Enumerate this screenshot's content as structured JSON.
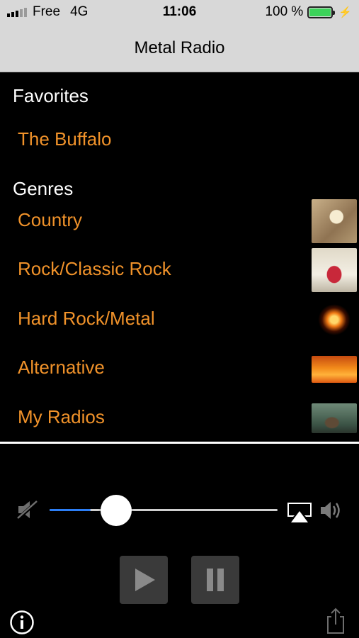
{
  "status_bar": {
    "carrier": "Free",
    "network": "4G",
    "time": "11:06",
    "battery_percent": "100 %",
    "battery_level": 1.0,
    "signal_bars_active": 3,
    "signal_bars_total": 5
  },
  "nav": {
    "title": "Metal Radio"
  },
  "favorites": {
    "header": "Favorites",
    "items": [
      {
        "label": "The Buffalo"
      }
    ]
  },
  "genres": {
    "header": "Genres",
    "items": [
      {
        "label": "Country",
        "thumb": "country-artwork-icon"
      },
      {
        "label": "Rock/Classic Rock",
        "thumb": "classic-rock-car-artwork-icon"
      },
      {
        "label": "Hard Rock/Metal",
        "thumb": "flaming-skull-artwork-icon"
      },
      {
        "label": "Alternative",
        "thumb": "silhouette-fire-artwork-icon"
      },
      {
        "label": "My Radios",
        "thumb": "vintage-radio-artwork-icon"
      }
    ]
  },
  "player": {
    "volume_level": 0.18,
    "icons": [
      "mute-icon",
      "airplay-icon",
      "speaker-icon",
      "play-icon",
      "pause-icon",
      "info-icon",
      "share-icon"
    ]
  },
  "colors": {
    "accent_orange": "#f0922a",
    "bar_gray": "#d8d8d8",
    "background": "#000000",
    "slider_blue": "#2c7ef5",
    "button_gray": "#3a3a3a"
  }
}
